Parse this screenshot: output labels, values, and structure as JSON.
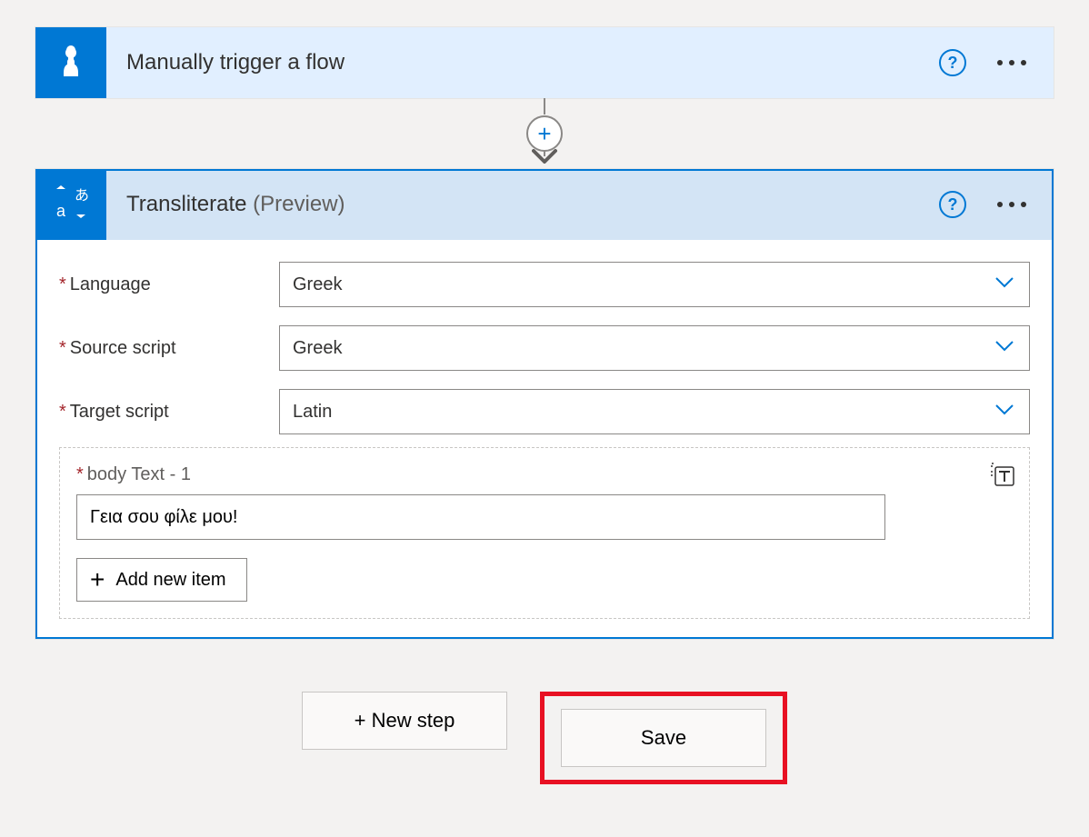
{
  "trigger": {
    "title": "Manually trigger a flow"
  },
  "action": {
    "title": "Transliterate",
    "suffix": "(Preview)",
    "fields": {
      "language": {
        "label": "Language",
        "value": "Greek"
      },
      "source_script": {
        "label": "Source script",
        "value": "Greek"
      },
      "target_script": {
        "label": "Target script",
        "value": "Latin"
      }
    },
    "body_item": {
      "label": "body Text - 1",
      "value": "Γεια σου φίλε μου!"
    },
    "add_item_label": "Add new item"
  },
  "footer": {
    "new_step": "+ New step",
    "save": "Save"
  },
  "help_glyph": "?",
  "plus_glyph": "+"
}
